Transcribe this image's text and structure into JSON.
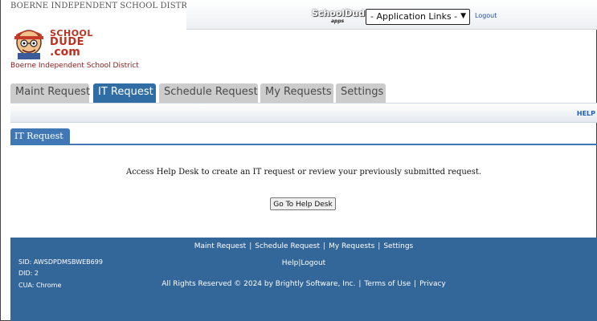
{
  "header": {
    "district_top": "BOERNE INDEPENDENT SCHOOL DISTRICT",
    "apps_brand": "SchoolDude",
    "apps_sub": "apps",
    "app_links_selected": "- Application Links -",
    "logout": "Logout",
    "logo_line1": "SCHOOL",
    "logo_line2": "DUDE",
    "logo_line3": ".com",
    "district_name": "Boerne Independent School District"
  },
  "tabs": [
    {
      "label": "Maint Request",
      "active": false
    },
    {
      "label": "IT Request",
      "active": true
    },
    {
      "label": "Schedule Request",
      "active": false
    },
    {
      "label": "My Requests",
      "active": false
    },
    {
      "label": "Settings",
      "active": false
    }
  ],
  "help_link": "HELP",
  "subtab": "IT Request",
  "main": {
    "message": "Access Help Desk to create an IT request or review your previously submitted request.",
    "go_button": "Go To Help Desk"
  },
  "footer": {
    "links": [
      "Maint Request",
      "Schedule Request",
      "My Requests",
      "Settings"
    ],
    "links2": [
      "Help",
      "Logout"
    ],
    "copyright": "All Rights Reserved © 2024 by Brightly Software, Inc.",
    "terms": "Terms of Use",
    "privacy": "Privacy",
    "sid": "SID: AWSDPDMSBWEB699",
    "did": "DID: 2",
    "cua": "CUA: Chrome"
  },
  "colors": {
    "tab_active": "#2f6da4",
    "tab_inactive": "#cccccc",
    "footer_bg": "#336699",
    "district_red": "#8b1a1a"
  }
}
